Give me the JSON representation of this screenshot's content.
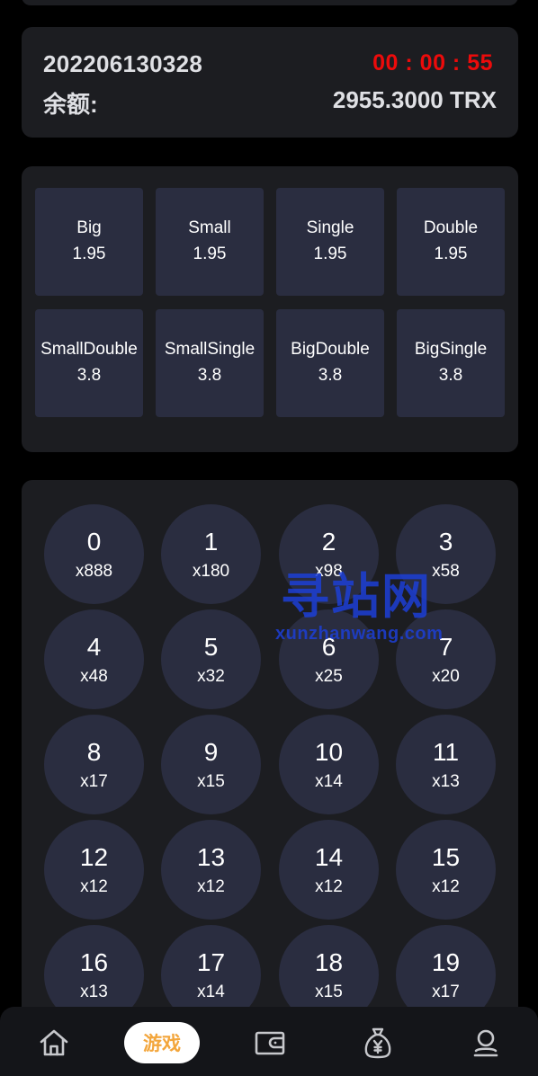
{
  "info": {
    "period": "202206130328",
    "countdown": "00 : 00 : 55",
    "balance_label": "余额:",
    "balance_value": "2955.3000 TRX"
  },
  "bets": [
    {
      "name": "Big",
      "odds": "1.95"
    },
    {
      "name": "Small",
      "odds": "1.95"
    },
    {
      "name": "Single",
      "odds": "1.95"
    },
    {
      "name": "Double",
      "odds": "1.95"
    },
    {
      "name": "SmallDouble",
      "odds": "3.8"
    },
    {
      "name": "SmallSingle",
      "odds": "3.8"
    },
    {
      "name": "BigDouble",
      "odds": "3.8"
    },
    {
      "name": "BigSingle",
      "odds": "3.8"
    }
  ],
  "numbers": [
    {
      "num": "0",
      "mult": "x888"
    },
    {
      "num": "1",
      "mult": "x180"
    },
    {
      "num": "2",
      "mult": "x98"
    },
    {
      "num": "3",
      "mult": "x58"
    },
    {
      "num": "4",
      "mult": "x48"
    },
    {
      "num": "5",
      "mult": "x32"
    },
    {
      "num": "6",
      "mult": "x25"
    },
    {
      "num": "7",
      "mult": "x20"
    },
    {
      "num": "8",
      "mult": "x17"
    },
    {
      "num": "9",
      "mult": "x15"
    },
    {
      "num": "10",
      "mult": "x14"
    },
    {
      "num": "11",
      "mult": "x13"
    },
    {
      "num": "12",
      "mult": "x12"
    },
    {
      "num": "13",
      "mult": "x12"
    },
    {
      "num": "14",
      "mult": "x12"
    },
    {
      "num": "15",
      "mult": "x12"
    },
    {
      "num": "16",
      "mult": "x13"
    },
    {
      "num": "17",
      "mult": "x14"
    },
    {
      "num": "18",
      "mult": "x15"
    },
    {
      "num": "19",
      "mult": "x17"
    }
  ],
  "watermark": {
    "cn": "寻站网",
    "en": "xunzhanwang.com"
  },
  "nav": {
    "home_icon": "home-icon",
    "game_label": "游戏",
    "wallet_icon": "wallet-icon",
    "money_bag_icon": "money-bag-icon",
    "profile_icon": "profile-icon"
  },
  "colors": {
    "countdown": "#ec0b0b",
    "active_nav": "#f3a63c",
    "tile": "#2a2d40",
    "card": "#1c1d21",
    "watermark": "#1d3fd6"
  }
}
